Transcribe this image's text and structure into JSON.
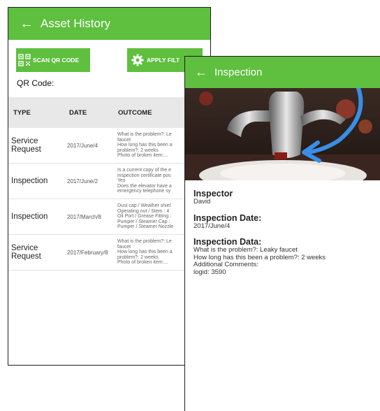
{
  "asset_history": {
    "back_icon": "arrow-left-icon",
    "title": "Asset History",
    "scan_button": "SCAN QR CODE",
    "apply_button": "APPLY FILT",
    "qr_label": "QR Code:",
    "columns": [
      "TYPE",
      "DATE",
      "OUTCOME"
    ],
    "rows": [
      {
        "type": "Service Request",
        "date": "2017/June/4",
        "outcome": [
          "What is the problem?: Le",
          "faucet",
          "How long has this been a",
          "problem?: 2 weeks",
          "Photo of broken item:..."
        ]
      },
      {
        "type": "Inspection",
        "date": "2017/June/2",
        "outcome": [
          "Is a current copy of the e",
          "inspection certificate pos",
          "Yes",
          "Does the elevator have a",
          "emergency telephone sy"
        ]
      },
      {
        "type": "Inspection",
        "date": "2017/March/8",
        "outcome": [
          "Dust cap / Weather shiel",
          "Operating nut / Stem : 4",
          "Oil Port / Grease Fitting :",
          "Pumper / Steamer Cap :",
          "Pumper / Steamer Nozzle"
        ]
      },
      {
        "type": "Service Request",
        "date": "2017/February/8",
        "outcome": [
          "What is the problem?: Le",
          "faucet",
          "How long has this been a",
          "problem?: 2 weeks",
          "Photo of broken item:..."
        ]
      }
    ]
  },
  "inspection": {
    "back_icon": "arrow-left-icon",
    "title": "Inspection",
    "inspector_heading": "Inspector",
    "inspector": "David",
    "date_heading": "Inspection Date:",
    "date": "2017/June/4",
    "data_heading": "Inspection Data:",
    "data_lines": [
      "What is the problem?: Leaky faucet",
      "How long has this been a problem?: 2 weeks",
      "Additional Comments:",
      "logid: 3590"
    ]
  },
  "colors": {
    "accent": "#5fbf3e",
    "header_bg": "#e8e8e8",
    "arrow": "#3a8ee6"
  }
}
